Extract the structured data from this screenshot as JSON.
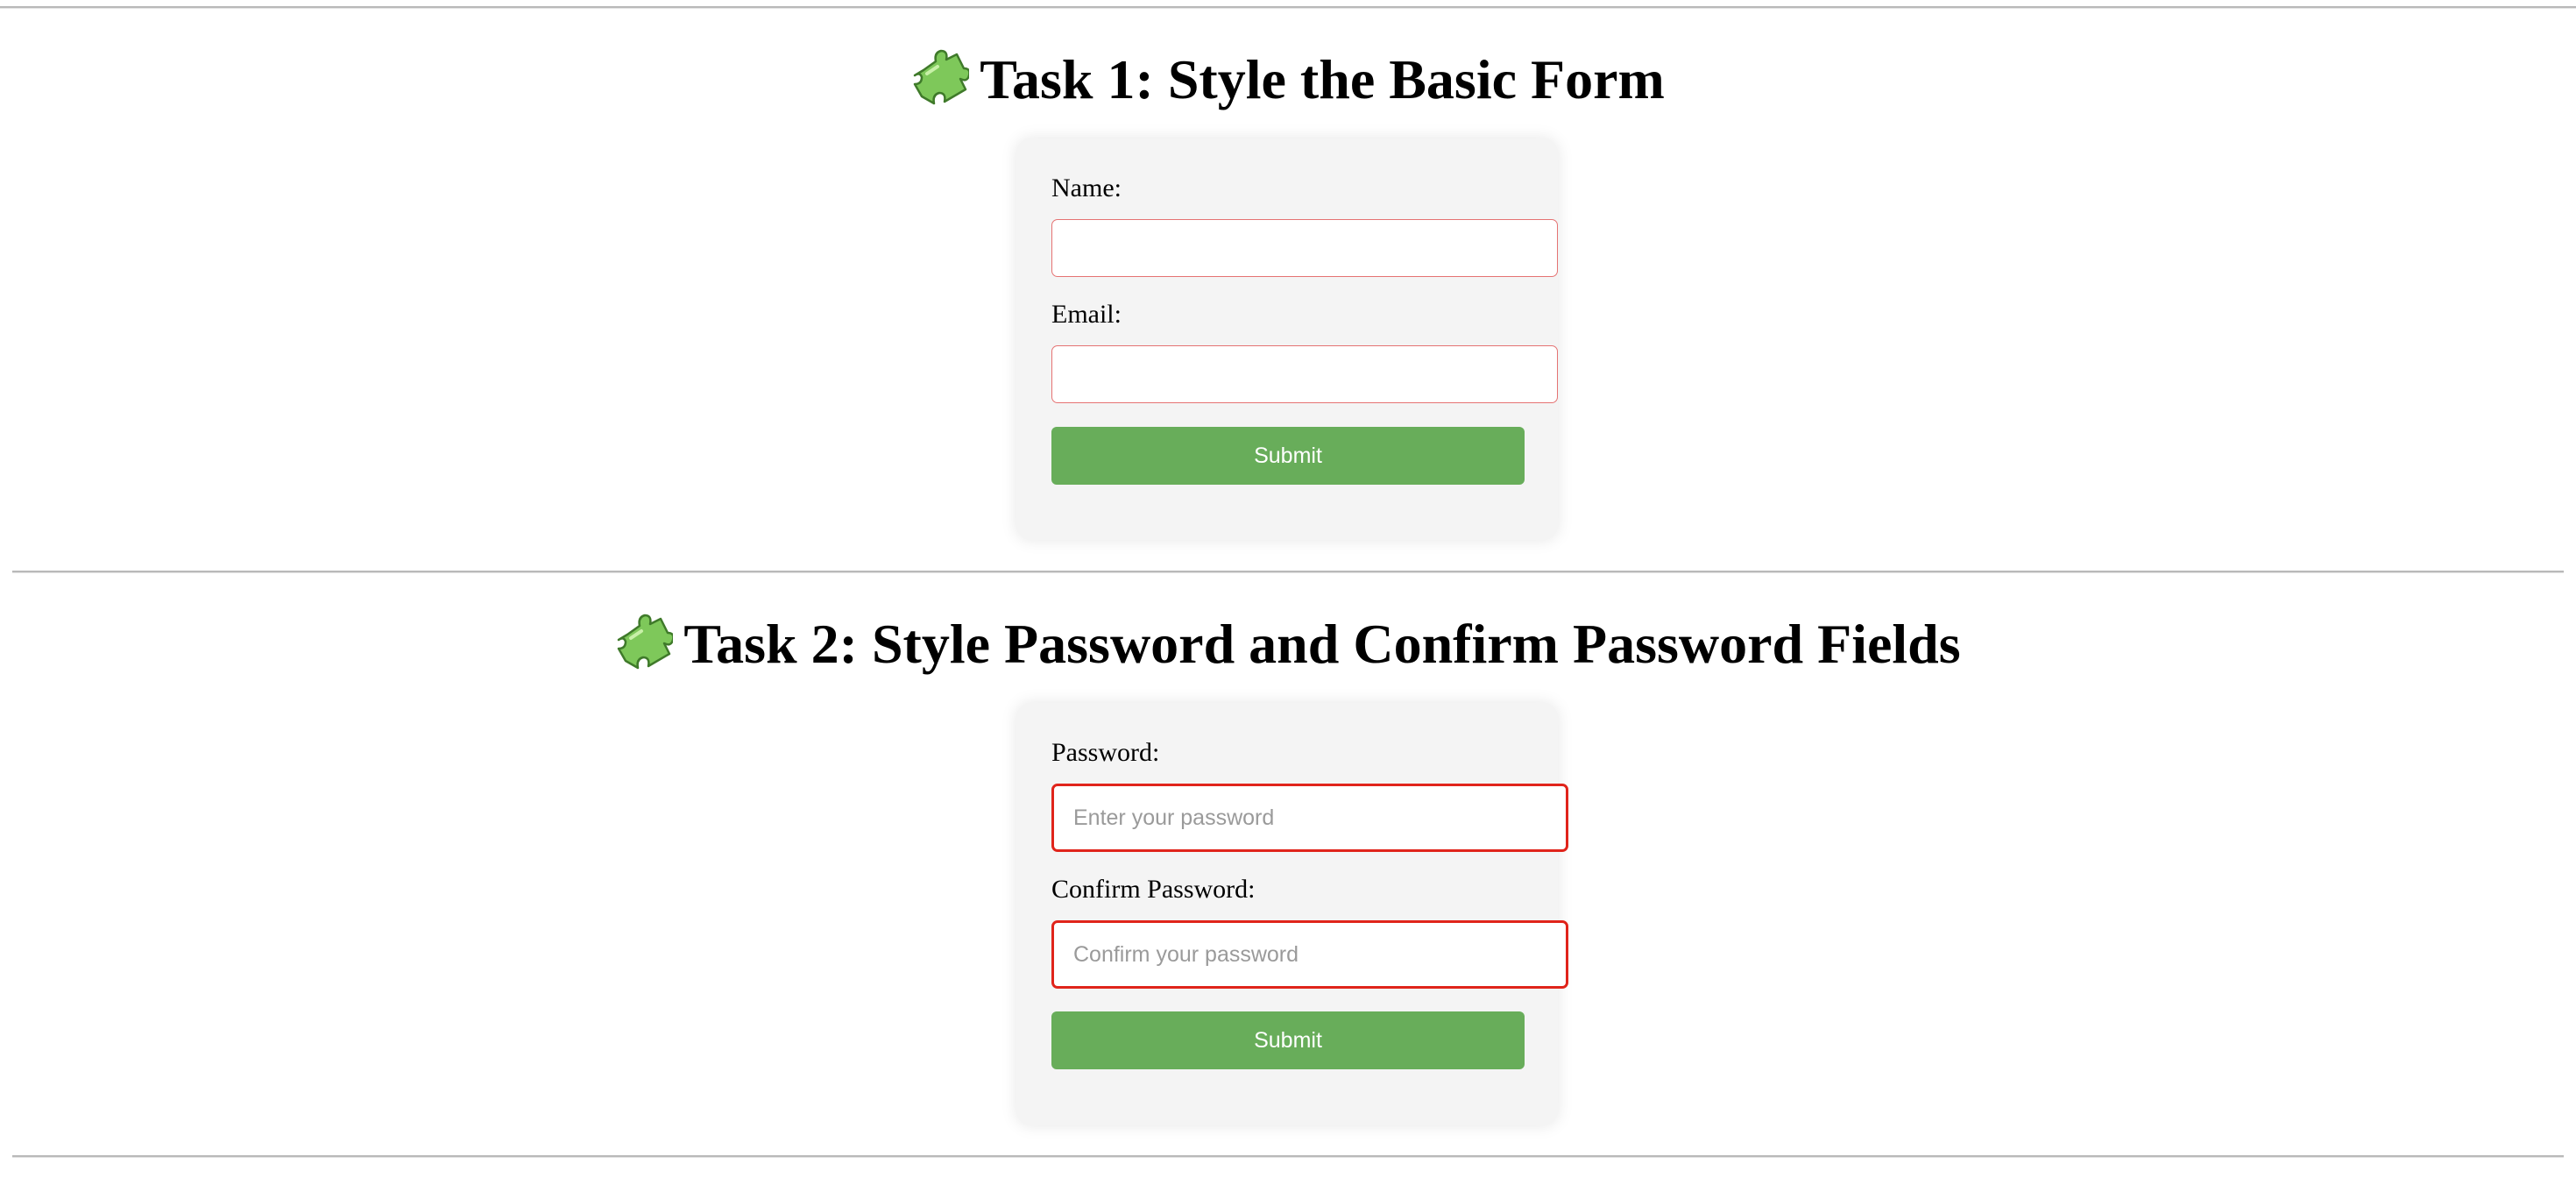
{
  "task1": {
    "heading": "Task 1: Style the Basic Form",
    "icon": "puzzle-piece-icon",
    "name_label": "Name:",
    "name_value": "",
    "email_label": "Email:",
    "email_value": "",
    "submit_label": "Submit"
  },
  "task2": {
    "heading": "Task 2: Style Password and Confirm Password Fields",
    "icon": "puzzle-piece-icon",
    "password_label": "Password:",
    "password_placeholder": "Enter your password",
    "confirm_label": "Confirm Password:",
    "confirm_placeholder": "Confirm your password",
    "submit_label": "Submit"
  },
  "colors": {
    "button_bg": "#68ad5a",
    "task1_input_border": "#e57373",
    "task2_input_border": "#e0241b",
    "card_bg": "#f4f4f4"
  }
}
